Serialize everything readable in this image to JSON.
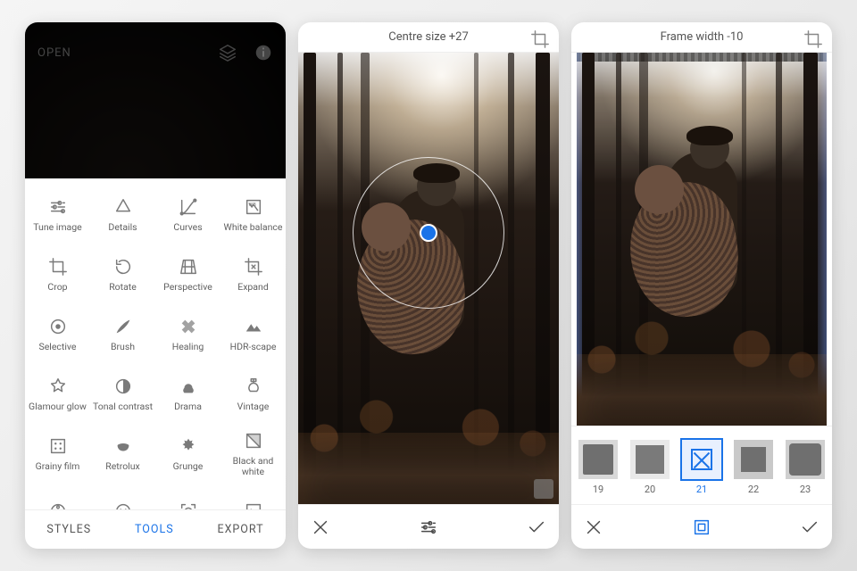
{
  "colors": {
    "accent": "#1a73e8"
  },
  "tabs": {
    "styles": "STYLES",
    "tools": "TOOLS",
    "export": "EXPORT",
    "active": "tools"
  },
  "open_label": "OPEN",
  "tools": [
    {
      "id": "tune-image",
      "label": "Tune image"
    },
    {
      "id": "details",
      "label": "Details"
    },
    {
      "id": "curves",
      "label": "Curves"
    },
    {
      "id": "white-balance",
      "label": "White balance"
    },
    {
      "id": "crop",
      "label": "Crop"
    },
    {
      "id": "rotate",
      "label": "Rotate"
    },
    {
      "id": "perspective",
      "label": "Perspective"
    },
    {
      "id": "expand",
      "label": "Expand"
    },
    {
      "id": "selective",
      "label": "Selective"
    },
    {
      "id": "brush",
      "label": "Brush"
    },
    {
      "id": "healing",
      "label": "Healing"
    },
    {
      "id": "hdr-scape",
      "label": "HDR-scape"
    },
    {
      "id": "glamour-glow",
      "label": "Glamour glow"
    },
    {
      "id": "tonal-contrast",
      "label": "Tonal contrast"
    },
    {
      "id": "drama",
      "label": "Drama"
    },
    {
      "id": "vintage",
      "label": "Vintage"
    },
    {
      "id": "grainy-film",
      "label": "Grainy film"
    },
    {
      "id": "retrolux",
      "label": "Retrolux"
    },
    {
      "id": "grunge",
      "label": "Grunge"
    },
    {
      "id": "black-and-white",
      "label": "Black and white"
    },
    {
      "id": "film-reel",
      "label": ""
    },
    {
      "id": "face-enhance",
      "label": ""
    },
    {
      "id": "face-pose",
      "label": ""
    },
    {
      "id": "misc",
      "label": ""
    }
  ],
  "phone2": {
    "param_label": "Centre size",
    "param_value": "+27",
    "header": "Centre size +27"
  },
  "phone3": {
    "param_label": "Frame width",
    "param_value": "-10",
    "header": "Frame width -10",
    "frames": [
      {
        "n": "19"
      },
      {
        "n": "20"
      },
      {
        "n": "21",
        "selected": true
      },
      {
        "n": "22"
      },
      {
        "n": "23"
      }
    ]
  }
}
